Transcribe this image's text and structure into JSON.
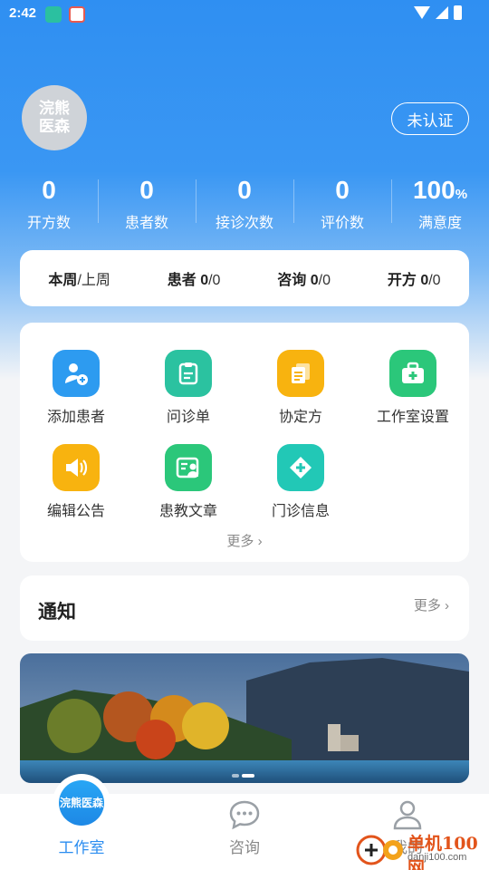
{
  "status_bar": {
    "time": "2:42"
  },
  "profile": {
    "avatar_text": "浣熊医森",
    "cert_button": "未认证"
  },
  "stats": [
    {
      "value": "0",
      "unit": "",
      "label": "开方数"
    },
    {
      "value": "0",
      "unit": "",
      "label": "患者数"
    },
    {
      "value": "0",
      "unit": "",
      "label": "接诊次数"
    },
    {
      "value": "0",
      "unit": "",
      "label": "评价数"
    },
    {
      "value": "100",
      "unit": "%",
      "label": "满意度"
    }
  ],
  "week_bar": {
    "this_week": "本周",
    "separator": "/上周",
    "patients_label": "患者",
    "patients_this": "0",
    "patients_last": "/0",
    "consult_label": "咨询",
    "consult_this": "0",
    "consult_last": "/0",
    "rx_label": "开方",
    "rx_this": "0",
    "rx_last": "/0"
  },
  "tools": [
    {
      "label": "添加患者",
      "icon": "add-patient-icon",
      "color": "#2d9bf0"
    },
    {
      "label": "问诊单",
      "icon": "clipboard-icon",
      "color": "#2bc2a0"
    },
    {
      "label": "协定方",
      "icon": "documents-icon",
      "color": "#f8b30f"
    },
    {
      "label": "工作室设置",
      "icon": "medkit-icon",
      "color": "#2bc77a"
    },
    {
      "label": "编辑公告",
      "icon": "speaker-icon",
      "color": "#f8b30f"
    },
    {
      "label": "患教文章",
      "icon": "article-icon",
      "color": "#2bc77a"
    },
    {
      "label": "门诊信息",
      "icon": "clinic-plus-icon",
      "color": "#22c8b6"
    }
  ],
  "tools_more": "更多",
  "notice": {
    "title": "通知",
    "more": "更多"
  },
  "tabs": [
    {
      "label": "工作室",
      "active": true
    },
    {
      "label": "咨询",
      "active": false
    },
    {
      "label": "我的",
      "active": false
    }
  ],
  "watermark": {
    "text": "单机100网",
    "url": "danji100.com"
  },
  "colors": {
    "primary": "#2b8df0",
    "hero_top": "#2f8ff2"
  }
}
